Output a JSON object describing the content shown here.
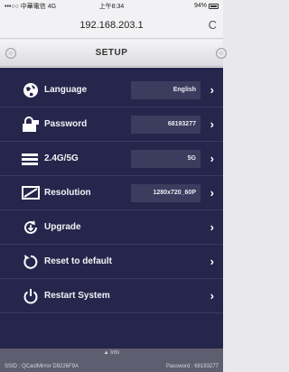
{
  "status": {
    "carrier": "•••○○ 中華電信 4G",
    "time": "上午8:34",
    "battery": "94%"
  },
  "browser": {
    "url": "192.168.203.1",
    "reload_icon": "reload-icon"
  },
  "header": {
    "title": "SETUP"
  },
  "menu": [
    {
      "id": "language",
      "label": "Language",
      "value": "English",
      "icon": "globe-icon"
    },
    {
      "id": "password",
      "label": "Password",
      "value": "68193277",
      "icon": "lock-icon"
    },
    {
      "id": "band",
      "label": "2.4G/5G",
      "value": "5G",
      "icon": "wifi-bands-icon"
    },
    {
      "id": "resolution",
      "label": "Resolution",
      "value": "1280x720_60P",
      "icon": "screen-icon"
    },
    {
      "id": "upgrade",
      "label": "Upgrade",
      "icon": "upgrade-icon"
    },
    {
      "id": "reset",
      "label": "Reset to default",
      "icon": "reset-icon"
    },
    {
      "id": "restart",
      "label": "Restart System",
      "icon": "power-icon"
    }
  ],
  "footer": {
    "info": "Info",
    "ssid": "SSID : QCastMirror D9226F9A",
    "password": "Password : 68193277"
  },
  "colors": {
    "menu_bg": "#26264c",
    "value_box": "#3c3c5f",
    "footer_bg": "#5e5e70"
  }
}
